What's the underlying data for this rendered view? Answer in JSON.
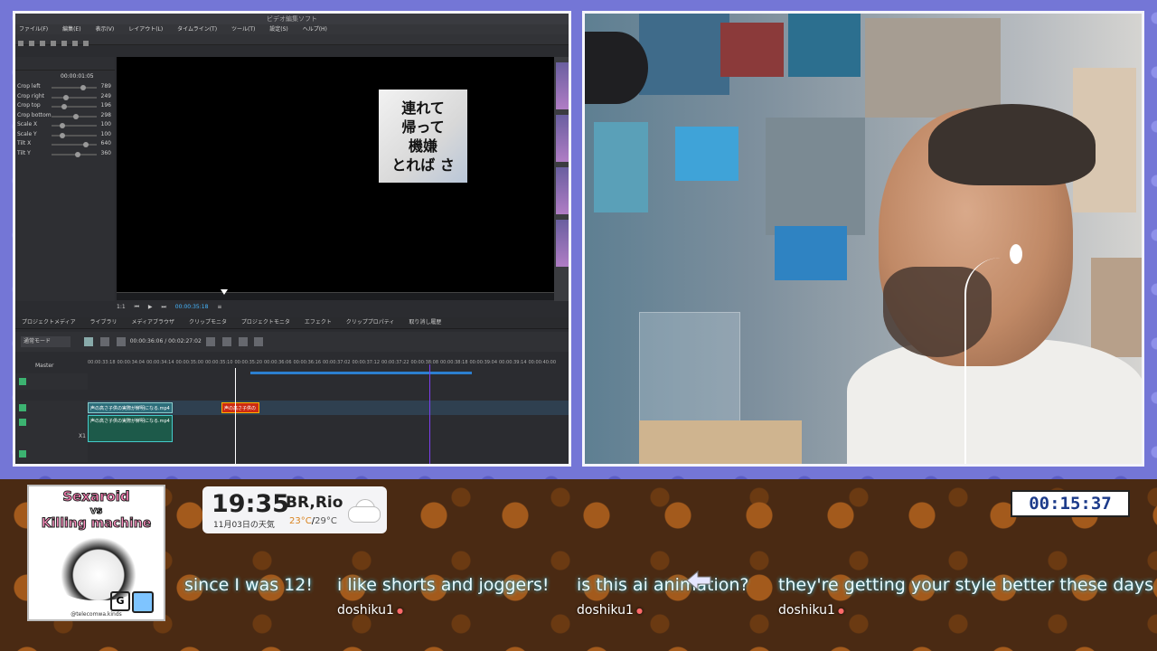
{
  "editor": {
    "title": "ビデオ編集ソフト",
    "menu": [
      "ファイル(F)",
      "編集(E)",
      "表示(V)",
      "レイアウト(L)",
      "タイムライン(T)",
      "ツール(T)",
      "設定(S)",
      "ヘルプ(H)"
    ],
    "property_time": "00:00:01:05",
    "properties": [
      {
        "label": "Crop left",
        "value": "789",
        "pos": 0.72
      },
      {
        "label": "Crop right",
        "value": "249",
        "pos": 0.3
      },
      {
        "label": "Crop top",
        "value": "196",
        "pos": 0.25
      },
      {
        "label": "Crop bottom",
        "value": "298",
        "pos": 0.55
      },
      {
        "label": "Scale X",
        "value": "100",
        "pos": 0.2
      },
      {
        "label": "Scale Y",
        "value": "100",
        "pos": 0.2
      },
      {
        "label": "Tilt X",
        "value": "640",
        "pos": 0.8
      },
      {
        "label": "Tilt Y",
        "value": "360",
        "pos": 0.6
      }
    ],
    "overlay_lines": [
      "連れて",
      "帰って",
      "機嫌",
      "とれば さ"
    ],
    "transport_speed": "1:1",
    "transport_timecode": "00:00:35:18",
    "tabs": [
      "プロジェクトメディア",
      "ライブラリ",
      "メディアブラウザ",
      "クリップモニタ",
      "プロジェクトモニタ",
      "エフェクト",
      "クリッププロパティ",
      "取り消し履歴"
    ],
    "tl_mode": "通常モード",
    "tl_time_position": "00:00:36:06",
    "tl_time_total": "00:02:27:02",
    "master_label": "Master",
    "ruler_ticks": [
      "00:00:33:18",
      "00:00:34:04",
      "00:00:34:14",
      "00:00:35:00",
      "00:00:35:10",
      "00:00:35:20",
      "00:00:36:06",
      "00:00:36:16",
      "00:00:37:02",
      "00:00:37:12",
      "00:00:37:22",
      "00:00:38:08",
      "00:00:38:18",
      "00:00:39:04",
      "00:00:39:14",
      "00:00:40:00"
    ],
    "clips": {
      "video1": "声の高さ子供の実際が鮮明になる.mp4",
      "title_clip": "声の高さ子供の",
      "audio1": "声の高さ子供の実際が鮮明になる.mp4",
      "audio_label": "X1"
    }
  },
  "overlay_widgets": {
    "art_title_1": "Sexaroid",
    "art_vs": "vs",
    "art_title_2": "Killing machine",
    "art_badge": "G",
    "art_footer": "@telecomwa.kinds",
    "weather": {
      "time": "19:35",
      "city": "BR,Rio",
      "date": "11月03日の天気",
      "temp_high": "23°C",
      "temp_separator": "/",
      "temp_low": "29°C",
      "icon": "cloud-icon"
    },
    "timer": "00:15:37"
  },
  "chat": [
    {
      "message": "since I was 12!",
      "user": ""
    },
    {
      "message": "i like shorts and joggers!",
      "user": "doshiku1"
    },
    {
      "message": "is this ai animation?",
      "user": "doshiku1"
    },
    {
      "message": "they're getting your style better these days",
      "user": "doshiku1"
    }
  ],
  "colors": {
    "frame_bg": "#7476d6",
    "bottom_bg": "#4a2a13",
    "chat_glow": "#54e0ff",
    "timer_text": "#1c3b8a",
    "timeline_playhead_marker": "#7d3ff0"
  }
}
